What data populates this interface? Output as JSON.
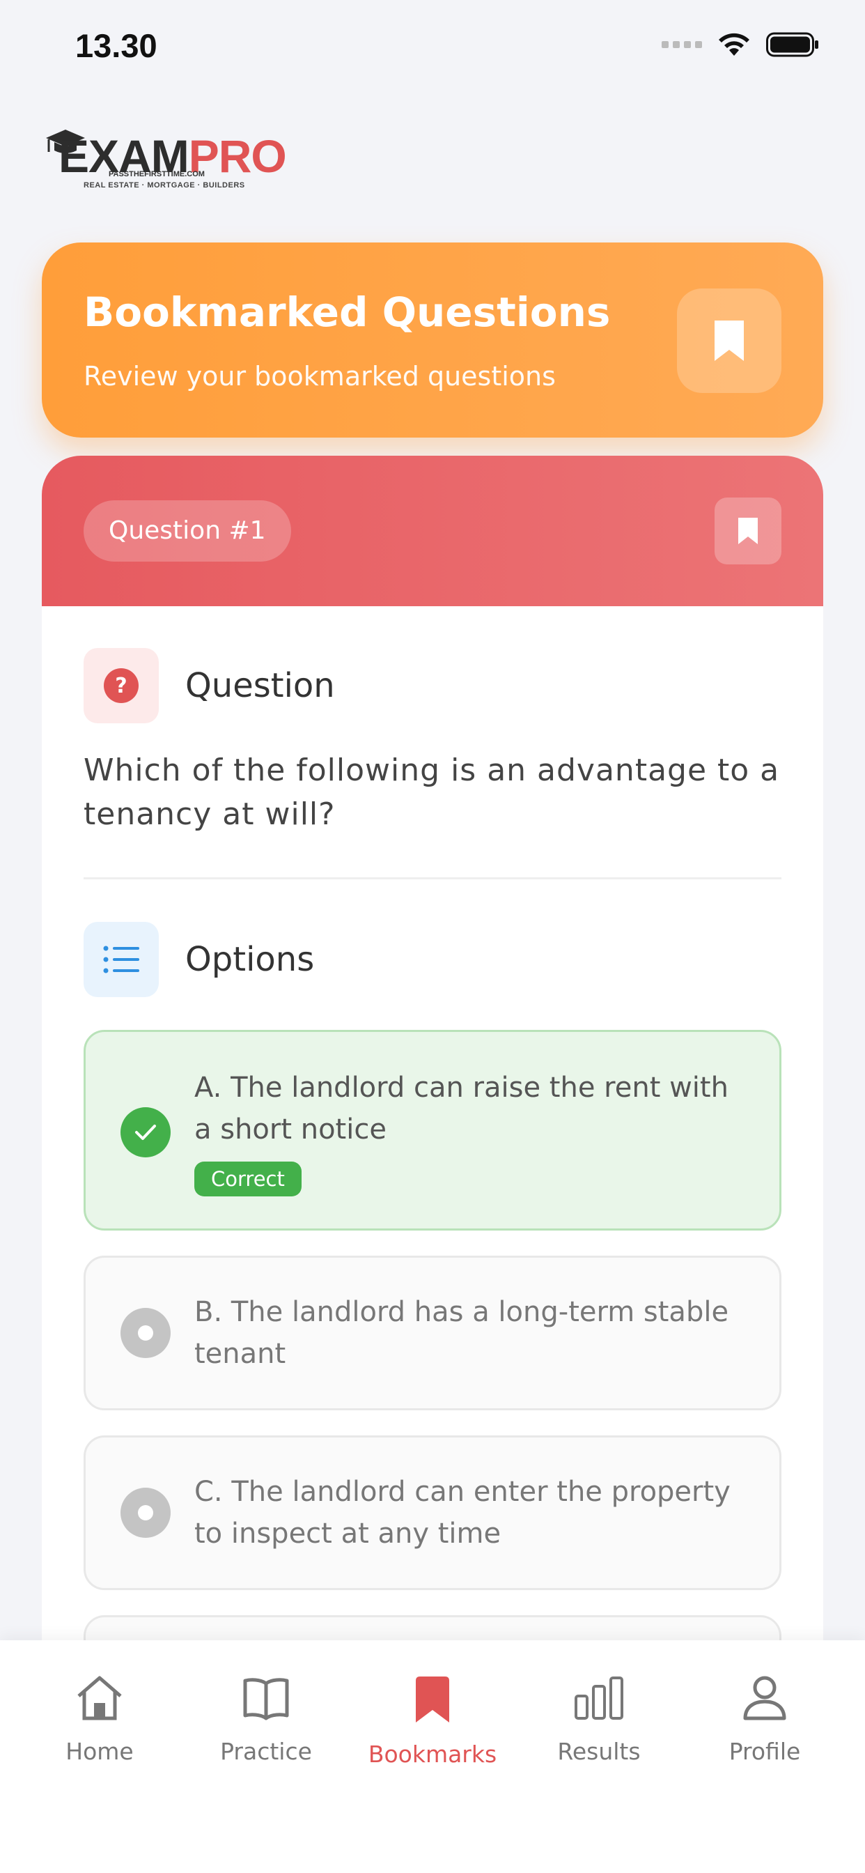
{
  "status_bar": {
    "time": "13.30"
  },
  "logo": {
    "brand_part1": "EXAM",
    "brand_part2": "PRO",
    "tagline": "PASSTHEFIRSTTIME.COM",
    "subtagline": "REAL ESTATE · MORTGAGE · BUILDERS"
  },
  "header": {
    "title": "Bookmarked Questions",
    "subtitle": "Review your bookmarked questions"
  },
  "question_card": {
    "badge": "Question #1",
    "question_section_label": "Question",
    "question_text": "Which of the following is an advantage to a tenancy at will?",
    "options_section_label": "Options",
    "options": [
      {
        "text": "A. The landlord can raise the rent with a short notice",
        "status": "correct",
        "tag": "Correct"
      },
      {
        "text": "B. The landlord has a long-term stable tenant",
        "status": "unselected"
      },
      {
        "text": "C. The landlord can enter the property to inspect at any time",
        "status": "unselected"
      }
    ]
  },
  "bottom_nav": {
    "items": [
      {
        "label": "Home",
        "icon": "home-icon"
      },
      {
        "label": "Practice",
        "icon": "book-icon"
      },
      {
        "label": "Bookmarks",
        "icon": "bookmark-icon",
        "active": true
      },
      {
        "label": "Results",
        "icon": "bar-chart-icon"
      },
      {
        "label": "Profile",
        "icon": "user-icon"
      }
    ]
  },
  "colors": {
    "accent_red": "#e05454",
    "header_orange": "#ffa048",
    "correct_green": "#43b04a",
    "info_blue": "#2e8fe0"
  }
}
